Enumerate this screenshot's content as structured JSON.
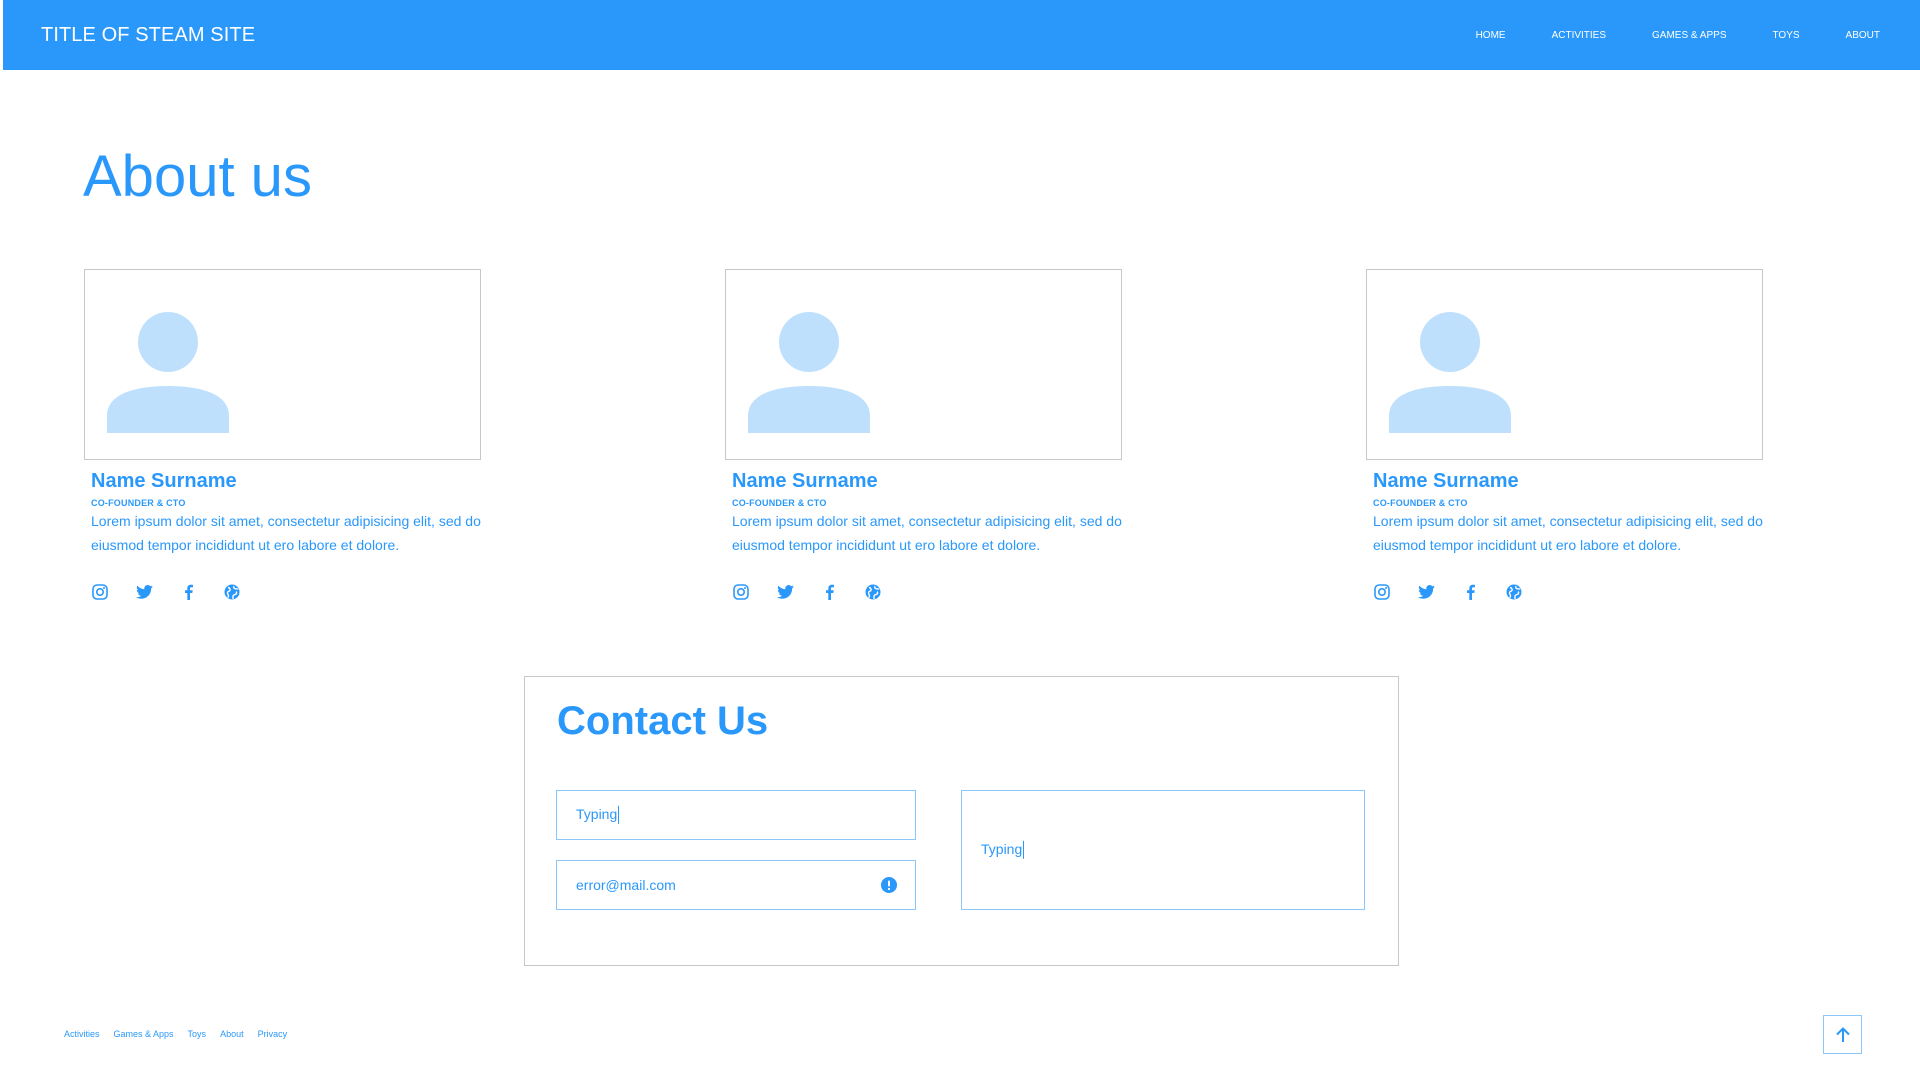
{
  "header": {
    "site_title": "TITLE OF STEAM SITE",
    "nav": [
      "HOME",
      "ACTIVITIES",
      "GAMES & APPS",
      "TOYS",
      "ABOUT"
    ]
  },
  "page_title": "About us",
  "team": [
    {
      "name": "Name Surname",
      "role": "CO-FOUNDER & CTO",
      "desc": "Lorem ipsum dolor sit amet, consectetur adipisicing elit, sed do eiusmod tempor incididunt ut ero labore et dolore.",
      "socials": [
        "instagram-icon",
        "twitter-icon",
        "facebook-icon",
        "globe-icon"
      ]
    },
    {
      "name": "Name Surname",
      "role": "CO-FOUNDER & CTO",
      "desc": "Lorem ipsum dolor sit amet, consectetur adipisicing elit, sed do eiusmod tempor incididunt ut ero labore et dolore.",
      "socials": [
        "instagram-icon",
        "twitter-icon",
        "facebook-icon",
        "globe-icon"
      ]
    },
    {
      "name": "Name Surname",
      "role": "CO-FOUNDER & CTO",
      "desc": "Lorem ipsum dolor sit amet, consectetur adipisicing elit, sed do eiusmod tempor incididunt ut ero labore et dolore.",
      "socials": [
        "instagram-icon",
        "twitter-icon",
        "facebook-icon",
        "globe-icon"
      ]
    }
  ],
  "contact": {
    "title": "Contact Us",
    "name_value": "Typing",
    "email_value": "error@mail.com",
    "message_value": "Typing"
  },
  "footer": {
    "links": [
      "Activities",
      "Games & Apps",
      "Toys",
      "About",
      "Privacy"
    ]
  },
  "colors": {
    "primary": "#2a98fa",
    "avatar": "#bfe0fd",
    "border": "#c8c8c8",
    "field_border": "#8cc7fb"
  }
}
